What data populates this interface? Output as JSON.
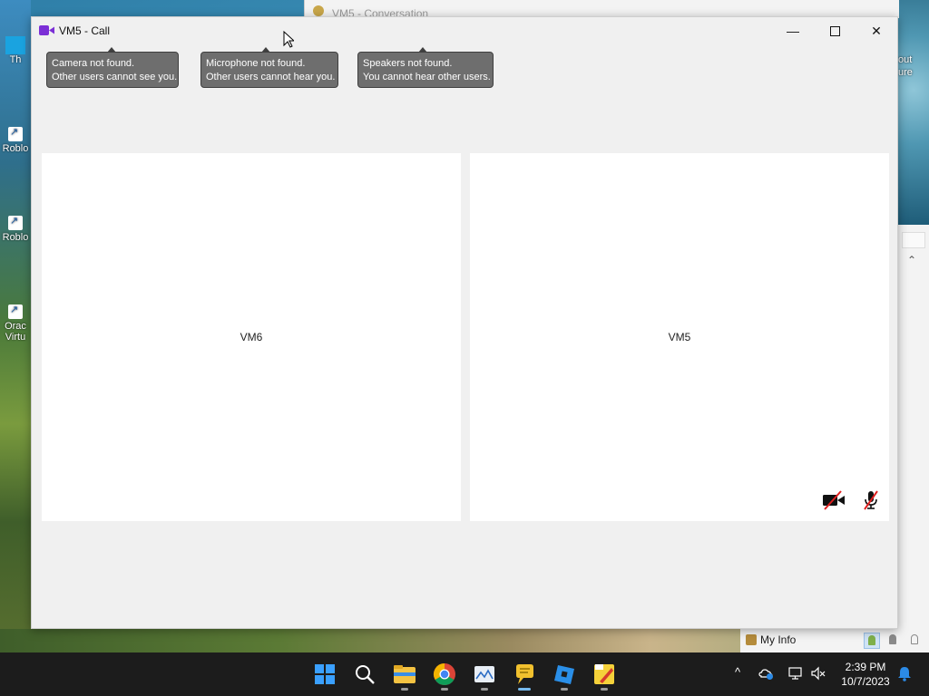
{
  "desktop": {
    "icons": [
      {
        "label": "Th"
      },
      {
        "label": "Roblo"
      },
      {
        "label": "Roblo"
      },
      {
        "label": "Orac"
      },
      {
        "label": "Virtu"
      }
    ],
    "right_labels": [
      "out",
      "ure"
    ]
  },
  "background_window": {
    "title": "VM5 - Conversation",
    "my_info_label": "My Info"
  },
  "call_window": {
    "title": "VM5 - Call",
    "controls": {
      "minimize": "—",
      "close": "✕"
    },
    "tooltips": {
      "camera": {
        "line1": "Camera not found.",
        "line2": "Other users cannot see you."
      },
      "microphone": {
        "line1": "Microphone not found.",
        "line2": "Other users cannot hear you."
      },
      "speakers": {
        "line1": "Speakers not found.",
        "line2": "You cannot hear other users."
      }
    },
    "participants": [
      {
        "name": "VM6"
      },
      {
        "name": "VM5"
      }
    ],
    "accent_color": "#7b2fd6"
  },
  "taskbar": {
    "apps": [
      "start-icon",
      "search-icon",
      "file-explorer-icon",
      "chrome-icon",
      "photos-icon",
      "messenger-icon",
      "roblox-studio-icon",
      "roblox-player-icon"
    ],
    "clock_time": "2:39 PM",
    "clock_date": "10/7/2023",
    "tray_chevron": "^"
  }
}
